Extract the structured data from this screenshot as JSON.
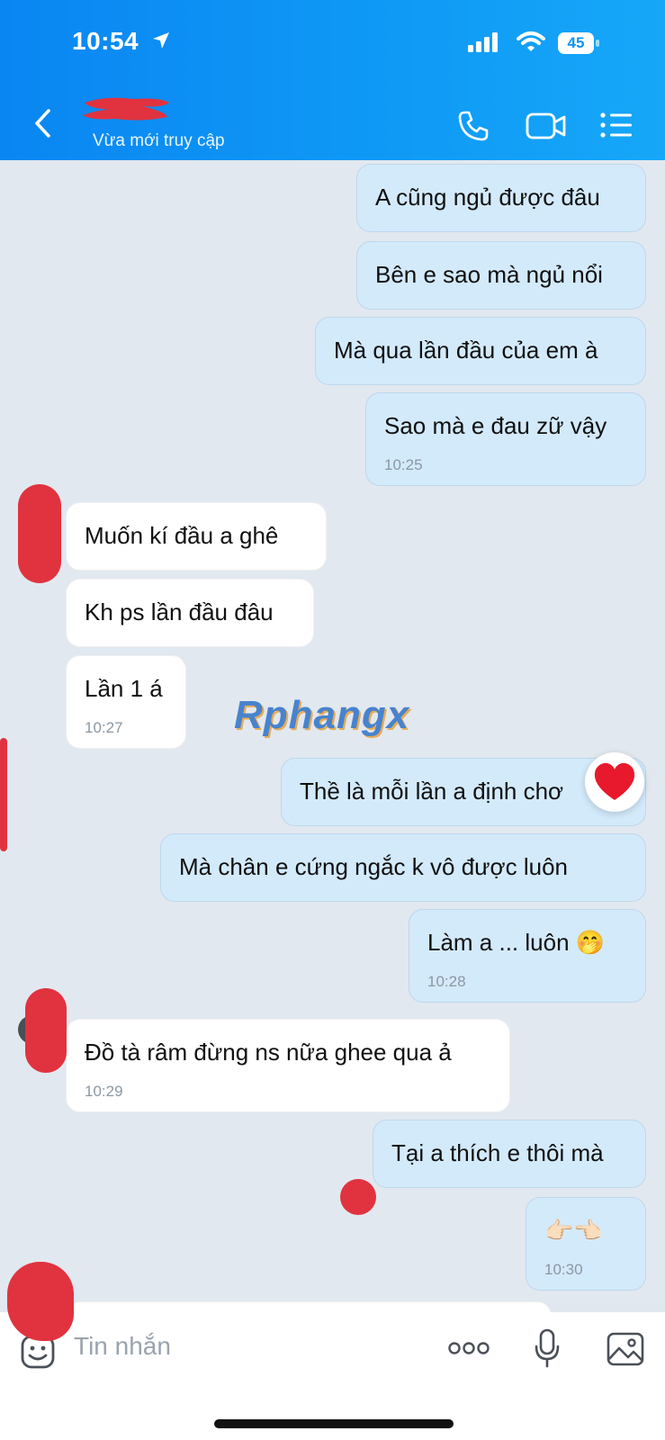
{
  "status_bar": {
    "time": "10:54",
    "battery": "45"
  },
  "header": {
    "contact_status": "Vừa mới truy cập"
  },
  "messages": [
    {
      "type": "sent",
      "text": "A cũng ngủ được đâu"
    },
    {
      "type": "sent",
      "text": "Bên e sao mà ngủ nổi"
    },
    {
      "type": "sent",
      "text": "Mà qua lần đầu của em à"
    },
    {
      "type": "sent",
      "text": "Sao mà e đau zữ vậy",
      "time": "10:25"
    },
    {
      "type": "received",
      "text": "Muốn kí đầu a ghê"
    },
    {
      "type": "received",
      "text": "Kh ps lần đầu đâu"
    },
    {
      "type": "received",
      "text": "Lần 1 á",
      "time": "10:27"
    },
    {
      "type": "sent",
      "text": "Thề là mỗi lần a định chơ",
      "reaction": "heart"
    },
    {
      "type": "sent",
      "text": "Mà chân e cứng ngắc k vô được luôn"
    },
    {
      "type": "sent",
      "text": "Làm a ... luôn 🤭",
      "time": "10:28"
    },
    {
      "type": "received",
      "text": "Đồ tà râm đừng ns nữa ghee qua ả",
      "time": "10:29"
    },
    {
      "type": "sent",
      "text": "Tại a thích e thôi mà"
    },
    {
      "type": "sent",
      "text": "👉🏻👈🏻",
      "time": "10:30"
    }
  ],
  "watermark": "Rphangx",
  "composer": {
    "placeholder": "Tin nhắn"
  },
  "icons": [
    "back-icon",
    "location-arrow-icon",
    "signal-icon",
    "wifi-icon",
    "battery-icon",
    "phone-icon",
    "video-call-icon",
    "menu-list-icon",
    "heart-reaction-icon",
    "sticker-emoji-icon",
    "more-dots-icon",
    "microphone-icon",
    "image-icon"
  ],
  "colors": {
    "header": "#0f94f5",
    "sent_bubble": "#d3eafb",
    "received_bubble": "#ffffff",
    "background": "#e2e8ef",
    "redaction": "#e0333f"
  }
}
